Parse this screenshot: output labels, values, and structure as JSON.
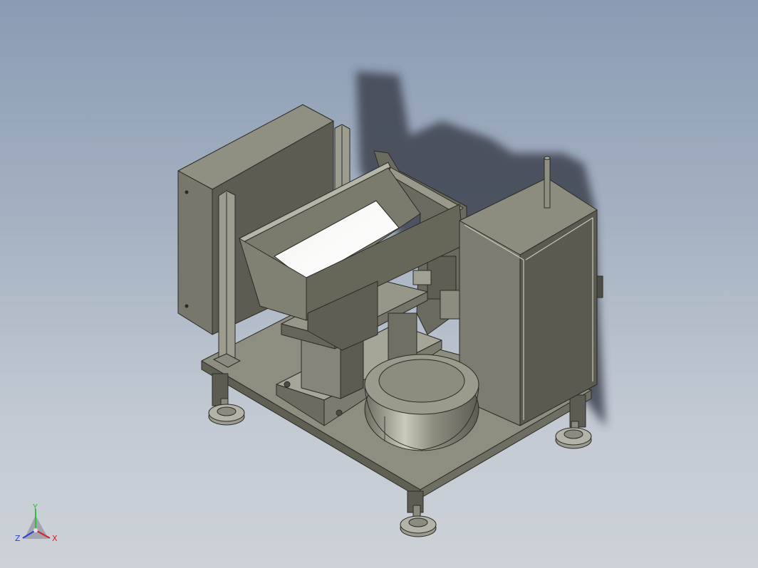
{
  "viewport": {
    "background_top": "#8a9bb3",
    "background_bottom": "#cdd2d8",
    "model_color": "#7a7a6c",
    "edge_color": "#2b2b27"
  },
  "triad": {
    "x_label": "X",
    "y_label": "Y",
    "z_label": "Z",
    "x_color": "#d42020",
    "y_color": "#2fbf2f",
    "z_color": "#2a3fd8"
  }
}
